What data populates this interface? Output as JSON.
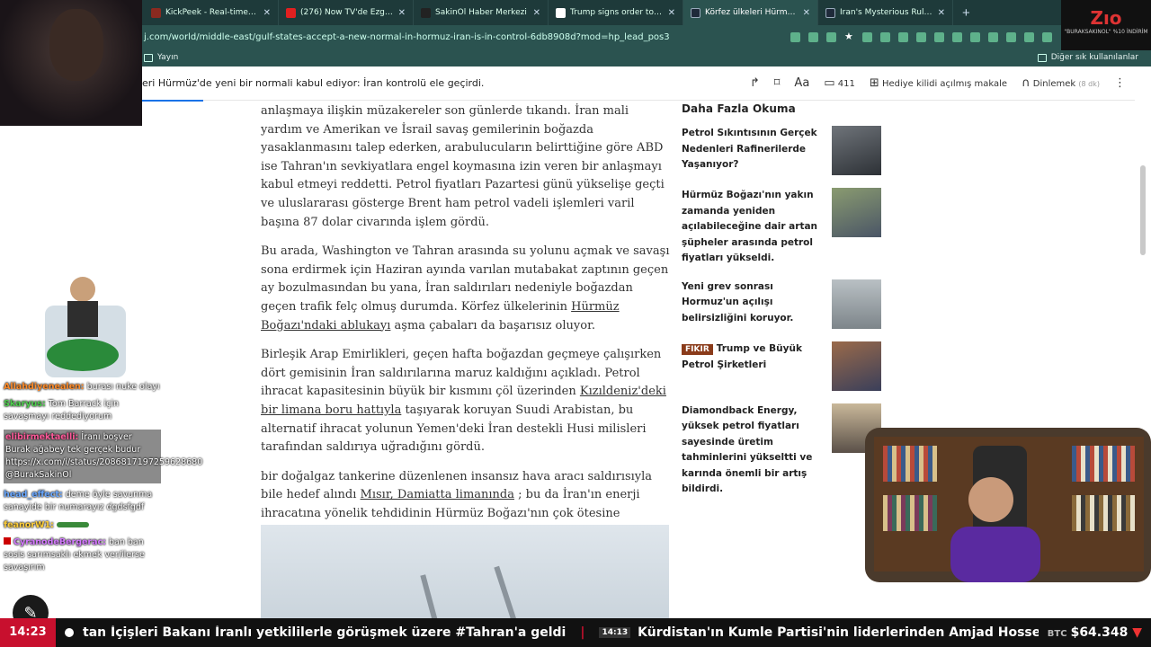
{
  "browser": {
    "tabs": [
      {
        "label": "KickPeek - Real-time URL Crawle",
        "color": "#8a2a20"
      },
      {
        "label": "(276) Now TV'de Ezgi Güzeger ile",
        "color": "#e02020"
      },
      {
        "label": "SakinOl Haber Merkezi",
        "color": "#222222"
      },
      {
        "label": "Trump signs order to limit childh",
        "color": "#ffffff"
      },
      {
        "label": "Körfez ülkeleri Hürmüz'de yeni b",
        "color": "#1f2a3a"
      },
      {
        "label": "Iran's Mysterious Ruler Signals a",
        "color": "#1f2a3a"
      }
    ],
    "new_tab": "+",
    "url": "j.com/world/middle-east/gulf-states-accept-a-new-normal-in-hormuz-iran-is-in-control-6db8908d?mod=hp_lead_pos3",
    "bookmark": "Yayın",
    "bookmarks_right": "Diğer sık kullanılanlar"
  },
  "header": {
    "title": "eri Hürmüz'de yeni bir normali kabul ediyor: İran kontrolü ele geçirdi.",
    "comments": "411",
    "gift": "Hediye kilidi açılmış makale",
    "listen": "Dinlemek",
    "listen_time": "(8 dk)"
  },
  "article": {
    "p1": "anlaşmaya ilişkin müzakereler son günlerde tıkandı. İran mali yardım ve Amerikan ve İsrail savaş gemilerinin boğazda yasaklanmasını talep ederken, arabulucuların belirttiğine göre ABD ise Tahran'ın sevkiyatlara engel koymasına izin veren bir anlaşmayı kabul etmeyi reddetti. Petrol fiyatları Pazartesi günü yükselişe geçti ve uluslararası gösterge Brent ham petrol vadeli işlemleri varil başına 87 dolar civarında işlem gördü.",
    "p2_pre": "Bu arada, Washington ve Tahran arasında su yolunu açmak ve savaşı sona erdirmek için Haziran ayında varılan mutabakat zaptının geçen ay bozulmasından bu yana, İran saldırıları nedeniyle boğazdan geçen trafik felç olmuş durumda. Körfez ülkelerinin ",
    "p2_link": "Hürmüz Boğazı'ndaki ablukayı",
    "p2_post": " aşma çabaları da başarısız oluyor.",
    "p3_pre": "Birleşik Arap Emirlikleri, geçen hafta boğazdan geçmeye çalışırken dört gemisinin İran saldırılarına maruz kaldığını açıkladı. Petrol ihracat kapasitesinin büyük bir kısmını çöl üzerinden ",
    "p3_link": "Kızıldeniz'deki bir limana boru hattıyla",
    "p3_post": " taşıyarak koruyan Suudi Arabistan, bu alternatif ihracat yolunun Yemen'deki İran destekli Husi milisleri tarafından saldırıya uğradığını gördü.",
    "p4_pre": "bir doğalgaz tankerine düzenlenen insansız hava aracı saldırısıyla bile hedef alındı ",
    "p4_link": "Mısır, Damiatta limanında",
    "p4_post": " ; bu da İran'ın enerji ihracatına yönelik tehdidinin Hürmüz Boğazı'nın çok ötesine uzandığını gösteriyor."
  },
  "sidebar": {
    "title": "Daha Fazla Okuma",
    "items": [
      {
        "text": "Petrol Sıkıntısının Gerçek Nedenleri Rafinerilerde Yaşanıyor?",
        "badge": ""
      },
      {
        "text": "Hürmüz Boğazı'nın yakın zamanda yeniden açılabileceğine dair artan şüpheler arasında petrol fiyatları yükseldi.",
        "badge": ""
      },
      {
        "text": "Yeni grev sonrası Hormuz'un açılışı belirsizliğini koruyor.",
        "badge": ""
      },
      {
        "text": "Trump ve Büyük Petrol Şirketleri",
        "badge": "FIKIR"
      },
      {
        "text": "Diamondback Energy, yüksek petrol fiyatları sayesinde üretim tahminlerini yükseltti ve karında önemli bir artış bildirdi.",
        "badge": ""
      }
    ]
  },
  "overlay": {
    "logo_main": "Zıo",
    "logo_sub": "\"BURAKSAKINOL\" %10 İNDİRİM",
    "chat": [
      {
        "user": "Allahdiyenealen:",
        "text": "burası nuke olayı",
        "color": "#ff8c2a"
      },
      {
        "user": "Skaryus:",
        "text": "Tom Barrack için savaşmayı reddediyorum",
        "color": "#4ecf4e"
      },
      {
        "user": "elibirmektaelli:",
        "text": "İranı boşver Burak ağabey tek gerçek budur https://x.com/i/status/2086817197259628680 @BurakSakinOl",
        "color": "#ff5a9a"
      },
      {
        "user": "head_effect:",
        "text": "deme öyle savunma sanayide bir numarayız dgdsfgdf",
        "color": "#6aa8ff"
      },
      {
        "user": "feanorW1:",
        "text": "",
        "color": "#ffcf3a"
      },
      {
        "user": "CyranodeBergerac:",
        "text": "ban ban sosis sarımsaklı ekmek ver/ilerse savaşırım",
        "color": "#d47aff"
      }
    ]
  },
  "ticker": {
    "time": "14:23",
    "headline1": "tan İçişleri Bakanı İranlı yetkililerle görüşmek üzere #Tahran'a geldi",
    "headline2_time": "14:13",
    "headline2": "Kürdistan'ın Kumle Partisi'nin liderlerinden Amjad Hossein Panahi, İran Uluslar",
    "btc_label": "BTC",
    "btc_value": "$64.348",
    "btc_arrow": "▼"
  }
}
